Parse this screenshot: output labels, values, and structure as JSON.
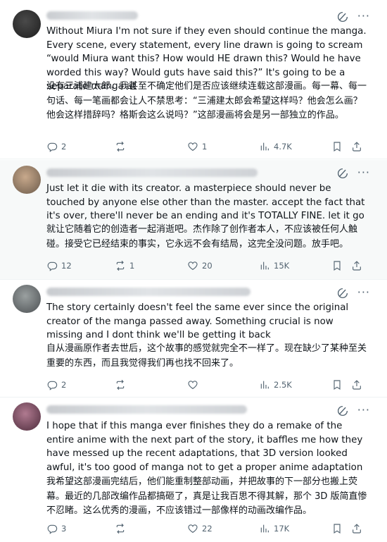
{
  "posts": [
    {
      "english": "Without Miura I'm not sure if they even should continue the manga. Every scene, every statement, every line drawn is going to scream “would Miura want this? How would HE drawn this? Would he have worded this way? Would guts have said this?” It's going to be a separate manga at",
      "chinese": "没有三浦建太郎，我甚至不确定他们是否应该继续连载这部漫画。每一幕、每一句话、每一笔画都会让人不禁思考：“三浦建太郎会希望这样吗？他会怎么画？他会这样措辞吗？格斯会这么说吗？”这部漫画将会是另一部独立的作品。",
      "replies": "2",
      "reposts": "",
      "likes": "1",
      "views": "4.7K"
    },
    {
      "english": "Just let it die with its creator. a masterpiece should never be touched by anyone else other than the master. accept the fact that it's over, there'll never be an ending and it's TOTALLY FINE. let it go",
      "chinese": "就让它随着它的创造者一起消逝吧。杰作除了创作者本人，不应该被任何人触碰。接受它已经结束的事实，它永远不会有结局，这完全没问题。放手吧。",
      "replies": "12",
      "reposts": "1",
      "likes": "20",
      "views": "15K"
    },
    {
      "english": "The story certainly doesn't feel the same ever since the original creator of the manga passed away. Something crucial is now missing and I dont think we'll be getting it back",
      "chinese": "自从漫画原作者去世后，这个故事的感觉就完全不一样了。现在缺少了某种至关重要的东西，而且我觉得我们再也找不回来了。",
      "replies": "2",
      "reposts": "",
      "likes": "",
      "views": "2.5K"
    },
    {
      "english": "I hope that if this manga ever finishes they do a remake of the entire anime with the next part of the story, it baffles me how they have messed up the recent adaptations, that 3D version looked awful, it's too good of manga not to get a proper anime adaptation",
      "chinese": "我希望这部漫画完结后，他们能重制整部动画，并把故事的下一部分也搬上荧幕。最近的几部改编作品都搞砸了，真是让我百思不得其解，那个 3D 版简直惨不忍睹。这么优秀的漫画，不应该错过一部像样的动画改编作品。",
      "replies": "3",
      "reposts": "",
      "likes": "22",
      "views": "17K"
    }
  ],
  "icons": {
    "reply": "reply-icon",
    "repost": "repost-icon",
    "like": "heart-icon",
    "views": "views-icon",
    "bookmark": "bookmark-icon",
    "share": "share-icon",
    "grok": "grok-icon",
    "more": "more-icon"
  },
  "colors": {
    "text": "#0f1419",
    "muted": "#536471",
    "divider": "#eff3f4"
  }
}
